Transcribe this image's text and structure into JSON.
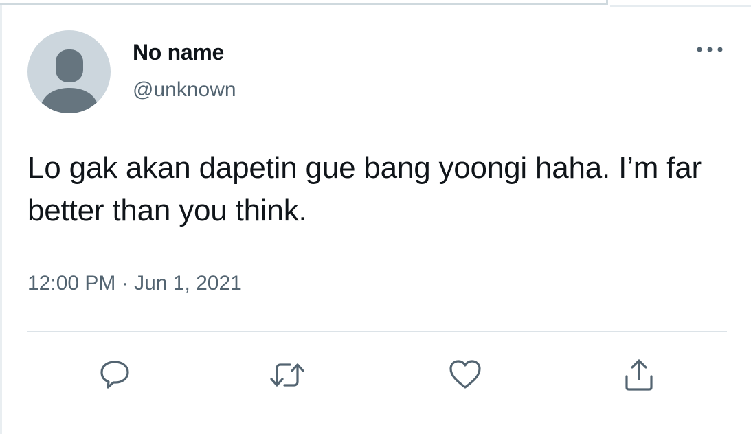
{
  "tweet": {
    "author": {
      "display_name": "No name",
      "handle": "@unknown",
      "avatar_icon": "default-avatar-icon"
    },
    "text": "Lo gak akan dapetin gue bang yoongi haha. I’m far better than you think.",
    "timestamp": "12:00 PM · Jun 1, 2021",
    "more_icon": "more-dots-icon",
    "actions": [
      {
        "name": "reply",
        "icon": "reply-icon"
      },
      {
        "name": "retweet",
        "icon": "retweet-icon"
      },
      {
        "name": "like",
        "icon": "heart-icon"
      },
      {
        "name": "share",
        "icon": "share-icon"
      }
    ]
  },
  "colors": {
    "text_primary": "#0f1419",
    "text_secondary": "#536471",
    "avatar_bg": "#ccd6dd",
    "avatar_fg": "#66757f",
    "divider": "#dce3e8"
  }
}
